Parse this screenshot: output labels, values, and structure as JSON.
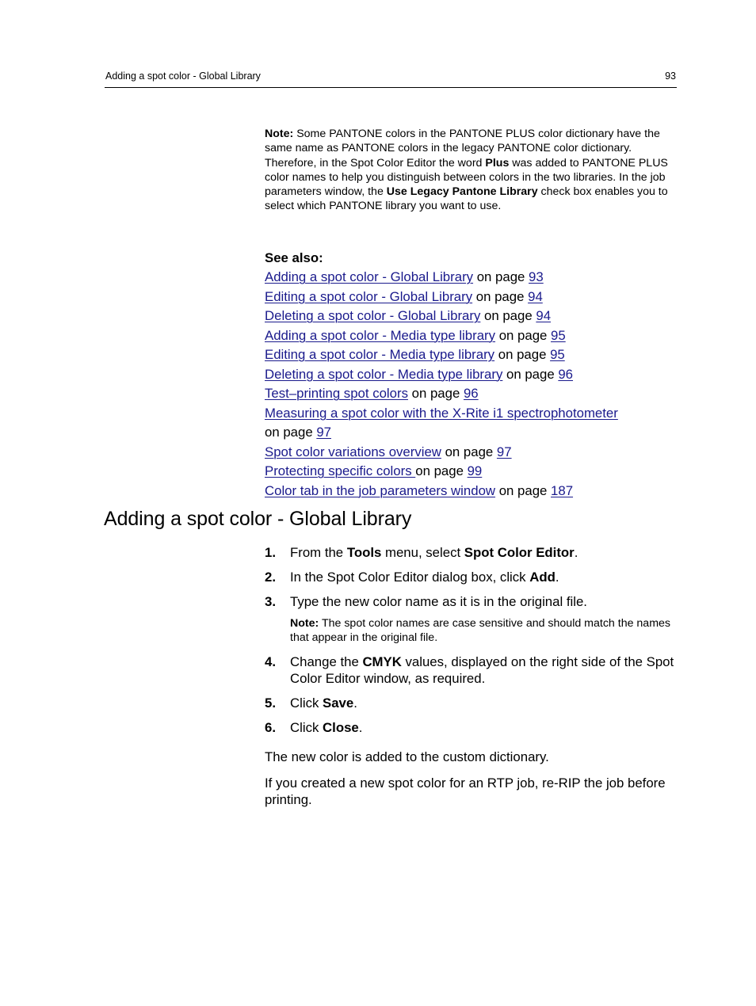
{
  "header": {
    "running_title": "Adding a spot color - Global Library",
    "page_number": "93"
  },
  "note": {
    "label": "Note:",
    "text_1": " Some PANTONE colors in the PANTONE PLUS color dictionary have the same name as PANTONE colors in the legacy PANTONE color dictionary. Therefore, in the Spot Color Editor the word ",
    "bold_1": "Plus",
    "text_2": " was added to PANTONE PLUS color names to help you distinguish between colors in the two libraries. In the job parameters window, the ",
    "bold_2": "Use Legacy Pantone Library",
    "text_3": " check box enables you to select which PANTONE library you want to use."
  },
  "see_also": {
    "heading": "See also:",
    "on_page": "on page",
    "items": [
      {
        "title": "Adding a spot color - Global Library",
        "page": "93"
      },
      {
        "title": "Editing a spot color - Global Library",
        "page": "94"
      },
      {
        "title": "Deleting a spot color - Global Library",
        "page": "94"
      },
      {
        "title": "Adding a spot color - Media type library",
        "page": "95"
      },
      {
        "title": "Editing a spot color - Media type library",
        "page": "95"
      },
      {
        "title": "Deleting a spot color - Media type library",
        "page": "96"
      },
      {
        "title": "Test–printing spot colors",
        "page": "96"
      },
      {
        "title": "Measuring a spot color with the X-Rite i1 spectrophotometer",
        "page": "97"
      },
      {
        "title": "Spot color variations overview",
        "page": "97"
      },
      {
        "title": "Protecting specific colors ",
        "page": "99"
      },
      {
        "title": "Color tab in the job parameters window",
        "page": "187"
      }
    ]
  },
  "section": {
    "title": "Adding a spot color - Global Library",
    "steps": [
      {
        "num": "1.",
        "parts": [
          "From the ",
          "Tools",
          " menu, select ",
          "Spot Color Editor",
          "."
        ]
      },
      {
        "num": "2.",
        "parts": [
          "In the Spot Color Editor dialog box, click ",
          "Add",
          "."
        ]
      },
      {
        "num": "3.",
        "parts": [
          "Type the new color name as it is in the original file."
        ]
      },
      {
        "num": "4.",
        "parts": [
          "Change the ",
          "CMYK",
          " values, displayed on the right side of the Spot Color Editor window, as required."
        ]
      },
      {
        "num": "5.",
        "parts": [
          "Click ",
          "Save",
          "."
        ]
      },
      {
        "num": "6.",
        "parts": [
          "Click ",
          "Close",
          "."
        ]
      }
    ],
    "step3_note": {
      "label": "Note:",
      "text": " The spot color names are case sensitive and should match the names that appear in the original file."
    },
    "result_1": "The new color is added to the custom dictionary.",
    "result_2": "If you created a new spot color for an RTP job, re-RIP the job before printing."
  },
  "colors": {
    "link": "#1a1a8c",
    "text": "#000000",
    "background": "#ffffff"
  }
}
